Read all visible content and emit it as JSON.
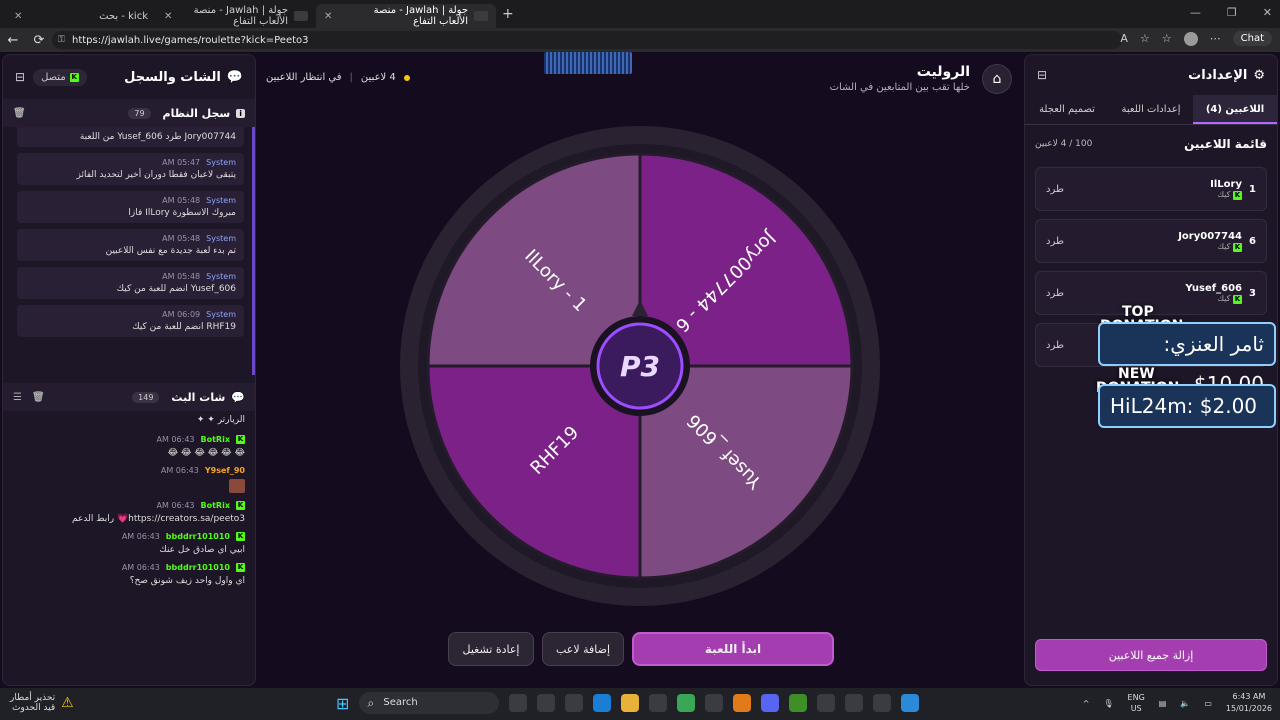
{
  "browser": {
    "tabs": [
      {
        "title": "kick - بحث",
        "active": false
      },
      {
        "title": "جولة | Jawlah - منصة الألعاب التفاع",
        "active": false
      },
      {
        "title": "جولة | Jawlah - منصة الألعاب التفاع",
        "active": true
      }
    ],
    "new_tab": "+",
    "url": "https://jawlah.live/games/roulette?kick=Peeto3",
    "chat_label": "Chat"
  },
  "left_panel": {
    "title": "الشات والسجل",
    "connection": "متصل",
    "system_log": {
      "title": "سجل النظام",
      "count": "79",
      "first_line": "Jory007744 طرد Yusef_606 من اللعبة",
      "items": [
        {
          "who": "System",
          "time": "05:47 AM",
          "text": "يتبقى لاعبان فقطا دوران أخير لتحديد الفائز"
        },
        {
          "who": "System",
          "time": "05:48 AM",
          "text": "مبروك الاسطورة IlLory فازا"
        },
        {
          "who": "System",
          "time": "05:48 AM",
          "text": "تم بدء لعبة جديدة مع نفس اللاعبين"
        },
        {
          "who": "System",
          "time": "05:48 AM",
          "text": "Yusef_606 انضم للعبة من كيك"
        },
        {
          "who": "System",
          "time": "06:09 AM",
          "text": "RHF19 انضم للعبة من كيك"
        }
      ]
    },
    "stream_chat": {
      "title": "شات البث",
      "count": "149",
      "first_line": "الريارتر",
      "messages": [
        {
          "user": "BotRix",
          "color": "#53fc18",
          "time": "06:43 AM",
          "text": "😂 😂 😂 😂 😂 😂"
        },
        {
          "user": "Y9sef_90",
          "color": "#f5a623",
          "time": "06:43 AM",
          "text": ""
        },
        {
          "user": "BotRix",
          "color": "#53fc18",
          "time": "06:43 AM",
          "text": "https://creators.sa/peeto3💗 رابط الدعم"
        },
        {
          "user": "bbddrr101010",
          "color": "#53fc18",
          "time": "06:43 AM",
          "text": "ابيي اي صادق خل عنك"
        },
        {
          "user": "bbddrr101010",
          "color": "#53fc18",
          "time": "06:43 AM",
          "text": "اي واول واحد زيف شونق صح؟"
        }
      ]
    }
  },
  "game": {
    "title": "الروليت",
    "subtitle": "خلها تقب بين المتابعين في الشات",
    "players_count": "4 لاعبين",
    "waiting": "في انتظار اللاعبين",
    "center_logo": "P3",
    "segments": [
      {
        "label": "Jory007744 - 6",
        "color": "#7b2187"
      },
      {
        "label": "Yusef _606",
        "color": "#7d4a82"
      },
      {
        "label": "RHF19",
        "color": "#7b2187"
      },
      {
        "label": "IlLory - 1",
        "color": "#7d4a82"
      }
    ],
    "buttons": {
      "start": "ابدأ اللعبة",
      "add": "إضافة لاعب",
      "restart": "إعادة تشغيل"
    }
  },
  "right_panel": {
    "title": "الإعدادات",
    "tabs": [
      "اللاعبين (4)",
      "إعدادات اللعبة",
      "تصميم العجلة"
    ],
    "list_title": "قائمة اللاعبين",
    "list_count": "100 / 4 لاعبين",
    "players": [
      {
        "num": "1",
        "name": "IlLory",
        "source": "كيك",
        "kick": "طرد"
      },
      {
        "num": "6",
        "name": "Jory007744",
        "source": "كيك",
        "kick": "طرد"
      },
      {
        "num": "3",
        "name": "Yusef_606",
        "source": "كيك",
        "kick": "طرد"
      },
      {
        "num": "",
        "name": "",
        "source": "",
        "kick": "طرد"
      }
    ],
    "remove_all": "إزالة جميع اللاعبين"
  },
  "overlays": {
    "top_label": "TOP",
    "top_sub": "DONATION",
    "top_value": "ثامر العنزي: 10.00$",
    "new_label": "NEW",
    "new_sub": "DONATION",
    "new_value": "HiL24m: $2.00"
  },
  "taskbar": {
    "weather_title": "تحذير أمطار",
    "weather_sub": "قيد الحدوث",
    "search": "Search",
    "lang": "ENG",
    "region": "US",
    "time": "6:43 AM",
    "date": "15/01/2026"
  }
}
